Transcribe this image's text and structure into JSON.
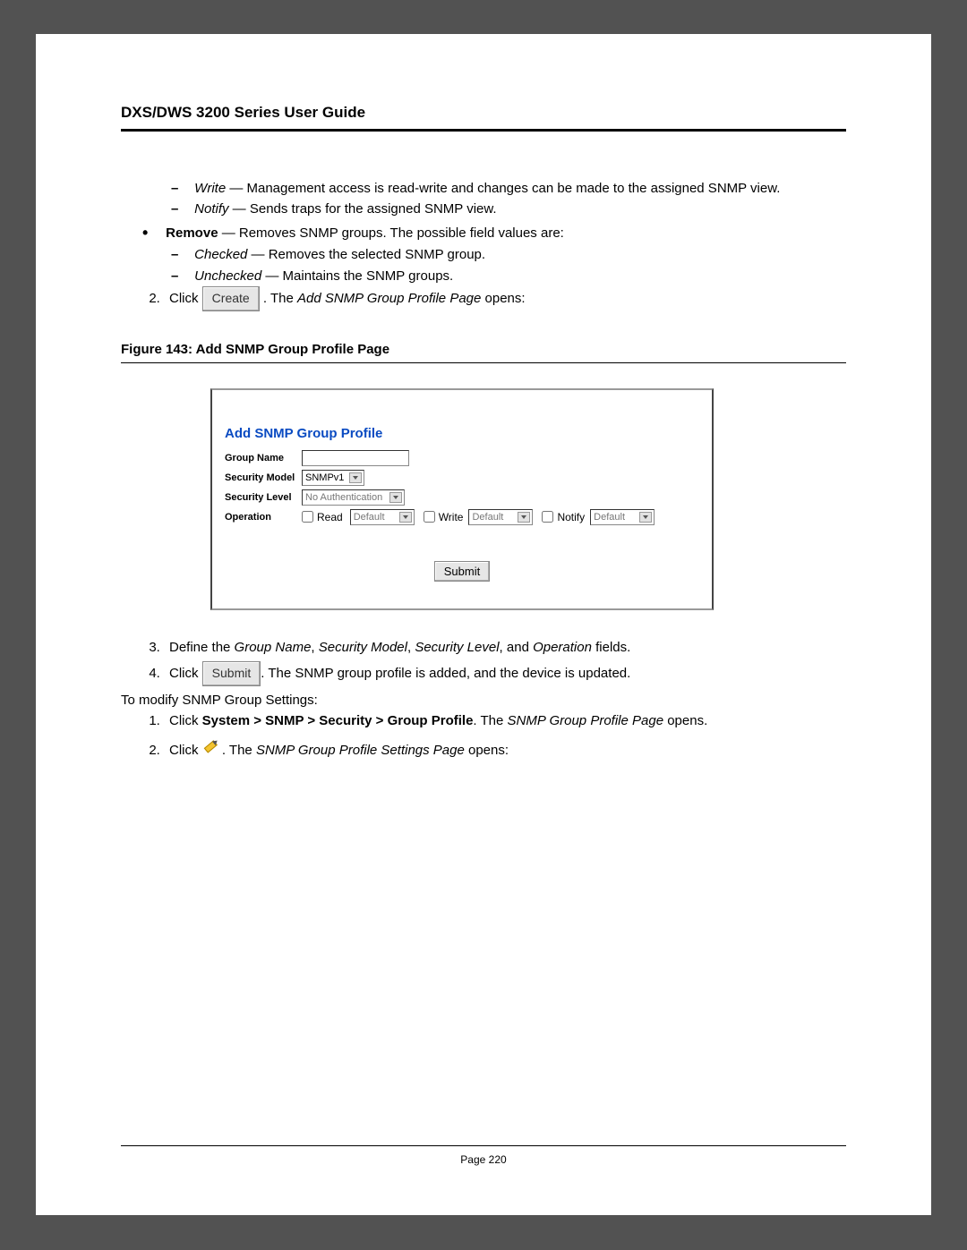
{
  "header": {
    "title": "DXS/DWS 3200 Series User Guide"
  },
  "bullets": {
    "write_term": "Write",
    "write_desc": " — Management access is read-write and changes can be made to the assigned SNMP view.",
    "notify_term": "Notify",
    "notify_desc": " — Sends traps for the assigned SNMP view.",
    "remove_term": "Remove",
    "remove_desc": " — Removes SNMP groups. The possible field values are:",
    "checked_term": "Checked",
    "checked_desc": " — Removes the selected SNMP group.",
    "unchecked_term": "Unchecked",
    "unchecked_desc": " — Maintains the SNMP groups."
  },
  "step2": {
    "click": "Click",
    "create_btn": "Create",
    "after1": ". The ",
    "page_name": "Add SNMP Group Profile Page",
    "after2": " opens:"
  },
  "figure_caption": "Figure 143:  Add SNMP Group Profile Page",
  "dialog": {
    "title": "Add SNMP Group Profile",
    "group_name_label": "Group Name",
    "sec_model_label": "Security Model",
    "sec_model_value": "SNMPv1",
    "sec_level_label": "Security Level",
    "sec_level_value": "No Authentication",
    "operation_label": "Operation",
    "read_label": "Read",
    "write_label": "Write",
    "notify_label": "Notify",
    "default_opt": "Default",
    "submit": "Submit"
  },
  "step3": {
    "prefix": "Define the ",
    "f1": "Group Name",
    "c1": ", ",
    "f2": "Security Model",
    "c2": ", ",
    "f3": "Security Level",
    "c3": ", and ",
    "f4": "Operation",
    "suffix": " fields."
  },
  "step4": {
    "click": "Click",
    "submit_btn": "Submit",
    "after": ". The SNMP group profile is added, and the device is updated."
  },
  "modify_line": "To modify SNMP Group Settings:",
  "mod_step1": {
    "click": "Click ",
    "path": "System > SNMP > Security > Group Profile",
    "after1": ". The ",
    "page": "SNMP Group Profile Page",
    "after2": " opens."
  },
  "mod_step2": {
    "click": "Click",
    "after1": ". The ",
    "page": "SNMP Group Profile Settings Page",
    "after2": " opens:"
  },
  "footer": "Page 220"
}
